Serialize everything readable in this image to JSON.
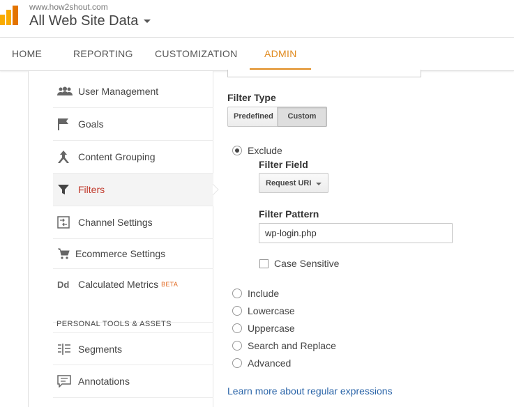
{
  "header": {
    "site_url": "www.how2shout.com",
    "view_name": "All Web Site Data"
  },
  "nav": {
    "tabs": [
      {
        "label": "HOME"
      },
      {
        "label": "REPORTING"
      },
      {
        "label": "CUSTOMIZATION"
      },
      {
        "label": "ADMIN",
        "active": true
      }
    ]
  },
  "sidebar": {
    "items": [
      {
        "label": "User Management",
        "icon": "users-icon"
      },
      {
        "label": "Goals",
        "icon": "flag-icon"
      },
      {
        "label": "Content Grouping",
        "icon": "content-grouping-icon"
      },
      {
        "label": "Filters",
        "icon": "filter-icon",
        "active": true
      },
      {
        "label": "Channel Settings",
        "icon": "channel-settings-icon"
      },
      {
        "label": "Ecommerce Settings",
        "icon": "cart-icon"
      },
      {
        "label": "Calculated Metrics",
        "badge": "BETA",
        "icon": "dd-icon"
      }
    ],
    "section_heading": "PERSONAL TOOLS & ASSETS",
    "tools": [
      {
        "label": "Segments",
        "icon": "segments-icon"
      },
      {
        "label": "Annotations",
        "icon": "annotations-icon"
      }
    ]
  },
  "filter_form": {
    "filter_type_label": "Filter Type",
    "filter_type_options": [
      "Predefined",
      "Custom"
    ],
    "filter_type_selected": "Custom",
    "options": [
      {
        "label": "Exclude",
        "checked": true
      },
      {
        "label": "Include",
        "checked": false
      },
      {
        "label": "Lowercase",
        "checked": false
      },
      {
        "label": "Uppercase",
        "checked": false
      },
      {
        "label": "Search and Replace",
        "checked": false
      },
      {
        "label": "Advanced",
        "checked": false
      }
    ],
    "filter_field_label": "Filter Field",
    "filter_field_value": "Request URI",
    "filter_pattern_label": "Filter Pattern",
    "filter_pattern_value": "wp-login.php",
    "case_sensitive_label": "Case Sensitive",
    "case_sensitive_checked": false,
    "learn_more_link": "Learn more about regular expressions"
  },
  "colors": {
    "accent": "#e08a1e",
    "active_sidebar_text": "#c0392b",
    "link": "#2a64a8",
    "beta": "#e0671e"
  }
}
